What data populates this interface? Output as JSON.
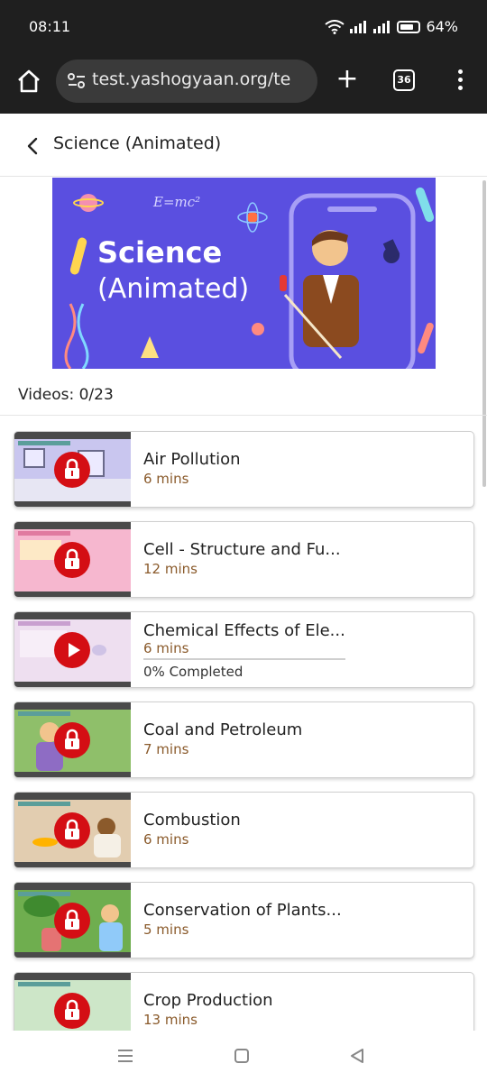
{
  "status_bar": {
    "time": "08:11",
    "battery": "64%"
  },
  "browser": {
    "url": "test.yashogyaan.org/te",
    "tab_count": "36"
  },
  "header": {
    "title": "Science (Animated)"
  },
  "banner": {
    "title": "Science",
    "subtitle": "(Animated)",
    "formula": "E=mc²"
  },
  "videos_count": "Videos: 0/23",
  "videos": [
    {
      "title": "Air Pollution",
      "duration": "6 mins",
      "state": "locked",
      "bg": "#c9c6ef"
    },
    {
      "title": "Cell - Structure and Fu...",
      "duration": "12 mins",
      "state": "locked",
      "bg": "#f6b7cf"
    },
    {
      "title": "Chemical Effects of Ele...",
      "duration": "6 mins",
      "state": "play",
      "bg": "#eedff0",
      "progress": "0% Completed"
    },
    {
      "title": "Coal and Petroleum",
      "duration": "7 mins",
      "state": "locked",
      "bg": "#8fbf6a"
    },
    {
      "title": "Combustion",
      "duration": "6 mins",
      "state": "locked",
      "bg": "#e2cdb0"
    },
    {
      "title": "Conservation of Plants...",
      "duration": "5 mins",
      "state": "locked",
      "bg": "#6fae4f"
    },
    {
      "title": "Crop Production",
      "duration": "13 mins",
      "state": "locked",
      "bg": "#cde6c8"
    }
  ],
  "colors": {
    "accent_red": "#d40e14",
    "duration_brown": "#8a5a2b",
    "banner_purple": "#5a4fe0"
  }
}
